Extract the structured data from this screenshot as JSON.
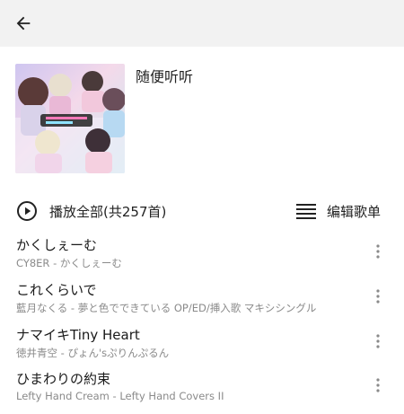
{
  "header": {
    "back_icon": "arrow-left-icon"
  },
  "playlist": {
    "title": "随便听听",
    "cover_icon": "album-art"
  },
  "actions": {
    "play_all_label": "播放全部(共257首)",
    "play_icon": "play-circle-icon",
    "edit_label": "编辑歌单",
    "edit_icon": "list-icon"
  },
  "songs": [
    {
      "title": "かくしぇーむ",
      "subtitle": "CY8ER - かくしぇーむ"
    },
    {
      "title": "これくらいで",
      "subtitle": "藍月なくる - 夢と色でできている OP/ED/挿入歌 マキシシングル"
    },
    {
      "title": "ナマイキTiny Heart",
      "subtitle": "徳井青空 - ぴょん'sぷりんぷるん"
    },
    {
      "title": "ひまわりの約束",
      "subtitle": "Lefty Hand Cream - Lefty Hand Covers II"
    }
  ],
  "colors": {
    "header_bg": "#f2f2f2",
    "text_primary": "#222222",
    "text_secondary": "#8a8a8a"
  }
}
